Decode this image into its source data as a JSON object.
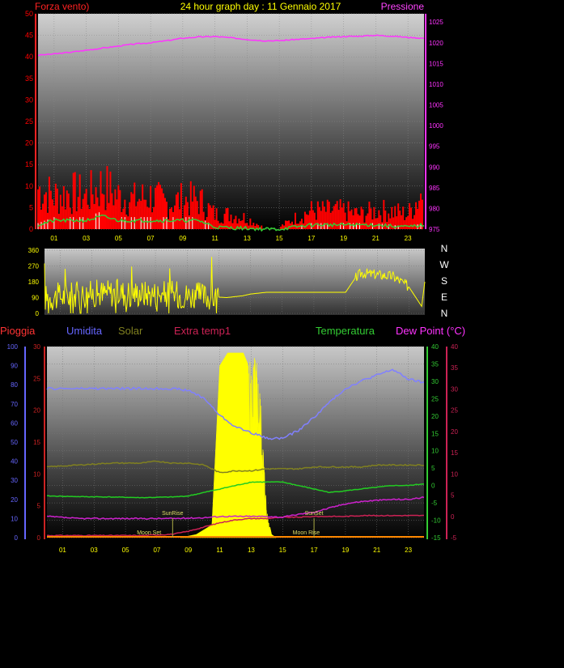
{
  "header": {
    "title": "24 hour graph day : 11 Gennaio 2017",
    "left_label": "Forza vento)",
    "right_label": "Pressione"
  },
  "legend_row": {
    "pioggia": "Pioggia",
    "umidita": "Umidita",
    "solar": "Solar",
    "extra_temp": "Extra temp1",
    "temperatura": "Temperatura",
    "dew_point": "Dew Point (°C)"
  },
  "colors": {
    "wind_gust": "#ff0000",
    "wind_avg": "#33cc33",
    "wind_low": "#ffffff",
    "pressure": "#ff33ff",
    "direction": "#ffff00",
    "humidity": "#8080ff",
    "solar": "#808020",
    "solar_fill": "#ffff00",
    "extra_temp": "#cc2255",
    "temperature": "#22cc22",
    "dew_point": "#cc22cc",
    "rain": "#ff3333",
    "axis_green": "#33cc33",
    "axis_red": "#cc2255",
    "axis_blue": "#6666ff",
    "axis_olive": "#cc2222"
  },
  "chart_data": [
    {
      "type": "line",
      "name": "wind_pressure",
      "x_tick_labels": [
        "01",
        "03",
        "05",
        "07",
        "09",
        "11",
        "13",
        "15",
        "17",
        "19",
        "21",
        "23"
      ],
      "left_axis": {
        "label": "Forza vento)",
        "ylim": [
          0,
          50
        ],
        "ticks": [
          0,
          5,
          10,
          15,
          20,
          25,
          30,
          35,
          40,
          45,
          50
        ]
      },
      "right_axis": {
        "label": "Pressione",
        "ylim": [
          975,
          1027
        ],
        "ticks": [
          975,
          980,
          985,
          990,
          995,
          1000,
          1005,
          1010,
          1015,
          1020,
          1025
        ]
      },
      "series": [
        {
          "name": "Pressione",
          "axis": "right",
          "x": [
            0,
            1,
            2,
            3,
            4,
            5,
            6,
            7,
            8,
            9,
            10,
            11,
            12,
            13,
            14,
            15,
            16,
            17,
            18,
            19,
            20,
            21,
            22,
            23,
            24
          ],
          "values": [
            1017,
            1017.3,
            1017.7,
            1018.2,
            1018.7,
            1019.2,
            1019.7,
            1020.0,
            1020.5,
            1021.1,
            1021.4,
            1021.5,
            1021.2,
            1020.8,
            1020.5,
            1020.5,
            1020.8,
            1021.0,
            1021.3,
            1021.5,
            1021.6,
            1021.8,
            1021.6,
            1021.3,
            1021.1
          ]
        },
        {
          "name": "gust",
          "axis": "left",
          "x": [
            0,
            1,
            2,
            3,
            4,
            5,
            6,
            7,
            8,
            9,
            10,
            11,
            12,
            13,
            14,
            15,
            16,
            17,
            18,
            19,
            20,
            21,
            22,
            23,
            24
          ],
          "values": [
            11,
            9,
            10,
            9,
            12,
            9,
            8,
            9,
            7,
            8,
            8,
            4,
            4,
            3,
            0.5,
            0.5,
            3,
            5,
            5,
            5,
            4,
            5,
            5,
            4,
            11
          ]
        },
        {
          "name": "average",
          "axis": "left",
          "x": [
            0,
            1,
            2,
            3,
            4,
            5,
            6,
            7,
            8,
            9,
            10,
            11,
            12,
            13,
            14,
            15,
            16,
            17,
            18,
            19,
            20,
            21,
            22,
            23,
            24
          ],
          "values": [
            1,
            2,
            2,
            2,
            3,
            2,
            2,
            2,
            2,
            2,
            2,
            0.5,
            0.3,
            0.2,
            0,
            0,
            0.5,
            1,
            1,
            1,
            1,
            1,
            0.7,
            0.5,
            1
          ]
        }
      ]
    },
    {
      "type": "line",
      "name": "wind_direction",
      "left_axis": {
        "ylim": [
          0,
          360
        ],
        "ticks": [
          0,
          90,
          180,
          270,
          360
        ]
      },
      "right_labels": [
        "N",
        "W",
        "S",
        "E",
        "N"
      ],
      "series": [
        {
          "name": "direction",
          "x": [
            0,
            4,
            8,
            10.5,
            11.5,
            12.5,
            13,
            14,
            15,
            16,
            17,
            18,
            19,
            19.6,
            20,
            21,
            22,
            23,
            23.8,
            24
          ],
          "values": [
            90,
            120,
            110,
            95,
            90,
            100,
            110,
            120,
            120,
            120,
            120,
            120,
            120,
            200,
            230,
            220,
            210,
            150,
            40,
            180
          ]
        }
      ]
    },
    {
      "type": "line",
      "name": "temperature_humidity",
      "x_tick_labels": [
        "01",
        "03",
        "05",
        "07",
        "09",
        "11",
        "13",
        "15",
        "17",
        "19",
        "21",
        "23"
      ],
      "humidity_axis": {
        "ylim": [
          0,
          100
        ],
        "ticks": [
          0,
          10,
          20,
          30,
          40,
          50,
          60,
          70,
          80,
          90,
          100
        ]
      },
      "rain_axis": {
        "ylim": [
          0,
          30
        ],
        "ticks": [
          0,
          5,
          10,
          15,
          20,
          25,
          30
        ]
      },
      "temp_axis": {
        "ylim": [
          -15,
          40
        ],
        "ticks": [
          -15,
          -10,
          -5,
          0,
          5,
          10,
          15,
          20,
          25,
          30,
          35,
          40
        ]
      },
      "dew_axis": {
        "ylim": [
          -5,
          40
        ],
        "ticks": [
          -5,
          0,
          5,
          10,
          15,
          20,
          25,
          30,
          35,
          40
        ]
      },
      "annotations": [
        "SunRise",
        "SunSet",
        "Moon Set",
        "Moon Rise"
      ],
      "series": [
        {
          "name": "Umidita",
          "axis": "humidity",
          "x": [
            0,
            2,
            4,
            6,
            8,
            9,
            10,
            11,
            12,
            13,
            14,
            15,
            16,
            17,
            18,
            19,
            20,
            21,
            22,
            23,
            24
          ],
          "values": [
            78,
            78,
            78,
            78,
            78,
            77,
            73,
            64,
            58,
            55,
            52,
            52,
            56,
            63,
            71,
            78,
            82,
            85,
            88,
            83,
            81
          ]
        },
        {
          "name": "Solar",
          "axis": "humidity",
          "x": [
            0,
            2,
            4,
            6,
            7,
            8,
            9,
            10,
            11,
            12,
            13,
            14,
            15,
            16,
            17,
            18,
            19,
            20,
            21,
            22,
            23,
            24
          ],
          "values": [
            37,
            38,
            39,
            39,
            40,
            39,
            39,
            38,
            34,
            35,
            35,
            36,
            36,
            36,
            37,
            37,
            37,
            37,
            38,
            38,
            38,
            38
          ]
        },
        {
          "name": "Temperatura",
          "axis": "temp",
          "x": [
            0,
            2,
            4,
            6,
            8,
            9,
            10,
            11,
            12,
            13,
            14,
            15,
            16,
            17,
            18,
            19,
            20,
            21,
            22,
            23,
            24
          ],
          "values": [
            -3,
            -3.2,
            -3.3,
            -3.5,
            -3.3,
            -3,
            -2,
            -1,
            0,
            1,
            1,
            1,
            0,
            -1,
            -2,
            -1.5,
            -1,
            -0.5,
            0,
            0,
            0.5
          ]
        },
        {
          "name": "Dew Point (°C)",
          "axis": "dew",
          "x": [
            0,
            2,
            4,
            6,
            8,
            10,
            11,
            12,
            13,
            14,
            15,
            16,
            17,
            18,
            19,
            20,
            21,
            22,
            23,
            24
          ],
          "values": [
            0,
            -0.5,
            -0.5,
            -0.5,
            -0.5,
            -0.3,
            0,
            0,
            0,
            0,
            -0.2,
            0.5,
            1,
            2,
            3,
            3.5,
            3.8,
            4,
            4,
            4.5
          ]
        },
        {
          "name": "Extra temp1",
          "axis": "dew",
          "x": [
            0,
            2,
            4,
            6,
            8,
            9,
            10,
            11,
            12,
            13,
            14,
            15,
            16,
            17,
            18,
            19,
            20,
            21,
            22,
            23,
            24
          ],
          "values": [
            -4.5,
            -4.5,
            -4.5,
            -4.5,
            -4.2,
            -3.5,
            -2.5,
            -1.5,
            -0.8,
            -0.5,
            -0.5,
            -0.2,
            -0.2,
            0,
            0,
            0,
            0.2,
            0.2,
            0.2,
            0.2,
            0.2
          ]
        },
        {
          "name": "Solar radiation",
          "axis": "rain",
          "x": [
            8.5,
            9.5,
            10.5,
            11,
            11.5,
            12,
            12.5,
            13,
            13.3,
            13.6,
            14,
            14.3,
            14.6
          ],
          "values": [
            0,
            0.5,
            2,
            27,
            29,
            29,
            29,
            26,
            28,
            22,
            4,
            0.5,
            0
          ]
        },
        {
          "name": "Pioggia",
          "axis": "rain",
          "x": [
            0,
            24
          ],
          "values": [
            0,
            0
          ]
        }
      ]
    }
  ]
}
